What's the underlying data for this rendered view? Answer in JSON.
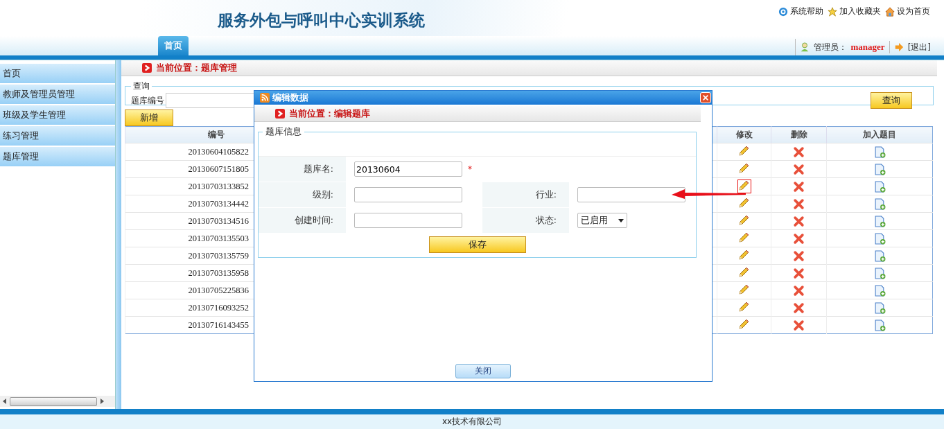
{
  "header": {
    "title": "服务外包与呼叫中心实训系统",
    "links": [
      {
        "label": "系统帮助",
        "kind": "help"
      },
      {
        "label": "加入收藏夹",
        "kind": "star"
      },
      {
        "label": "设为首页",
        "kind": "home"
      }
    ]
  },
  "tabs": [
    {
      "label": "首页",
      "selected": true
    }
  ],
  "user": {
    "role": "管理员：",
    "name": "manager",
    "logout": "[退出]"
  },
  "sidebar": {
    "items": [
      {
        "label": "首页"
      },
      {
        "label": "教师及管理员管理"
      },
      {
        "label": "班级及学生管理"
      },
      {
        "label": "练习管理"
      },
      {
        "label": "题库管理"
      }
    ]
  },
  "breadcrumb": "当前位置：题库管理",
  "query": {
    "legend": "查询",
    "label": "题库编号",
    "button": "查询"
  },
  "add_button": "新增",
  "table": {
    "columns": [
      "编号",
      "修改",
      "删除",
      "加入题目"
    ],
    "rows": [
      {
        "id": "20130604105822",
        "highlighted": false
      },
      {
        "id": "20130607151805",
        "highlighted": false
      },
      {
        "id": "20130703133852",
        "highlighted": true
      },
      {
        "id": "20130703134442",
        "highlighted": false
      },
      {
        "id": "20130703134516",
        "highlighted": false
      },
      {
        "id": "20130703135503",
        "highlighted": false
      },
      {
        "id": "20130703135759",
        "highlighted": false
      },
      {
        "id": "20130703135958",
        "highlighted": false
      },
      {
        "id": "20130705225836",
        "highlighted": false
      },
      {
        "id": "20130716093252",
        "highlighted": false
      },
      {
        "id": "20130716143455",
        "highlighted": false
      }
    ]
  },
  "dialog": {
    "title": "编辑数据",
    "breadcrumb": "当前位置：编辑题库",
    "legend": "题库信息",
    "rows": [
      [
        {
          "label": "题库名:",
          "kind": "text",
          "value": "20130604",
          "required_mark": "*"
        }
      ],
      [
        {
          "label": "级别:",
          "kind": "text"
        },
        {
          "label": "行业:",
          "kind": "text"
        }
      ],
      [
        {
          "label": "创建时间:",
          "kind": "text"
        },
        {
          "label": "状态:",
          "kind": "select",
          "value": "已启用"
        }
      ]
    ],
    "save": "保存",
    "close": "关闭"
  },
  "footer": "xx技术有限公司"
}
